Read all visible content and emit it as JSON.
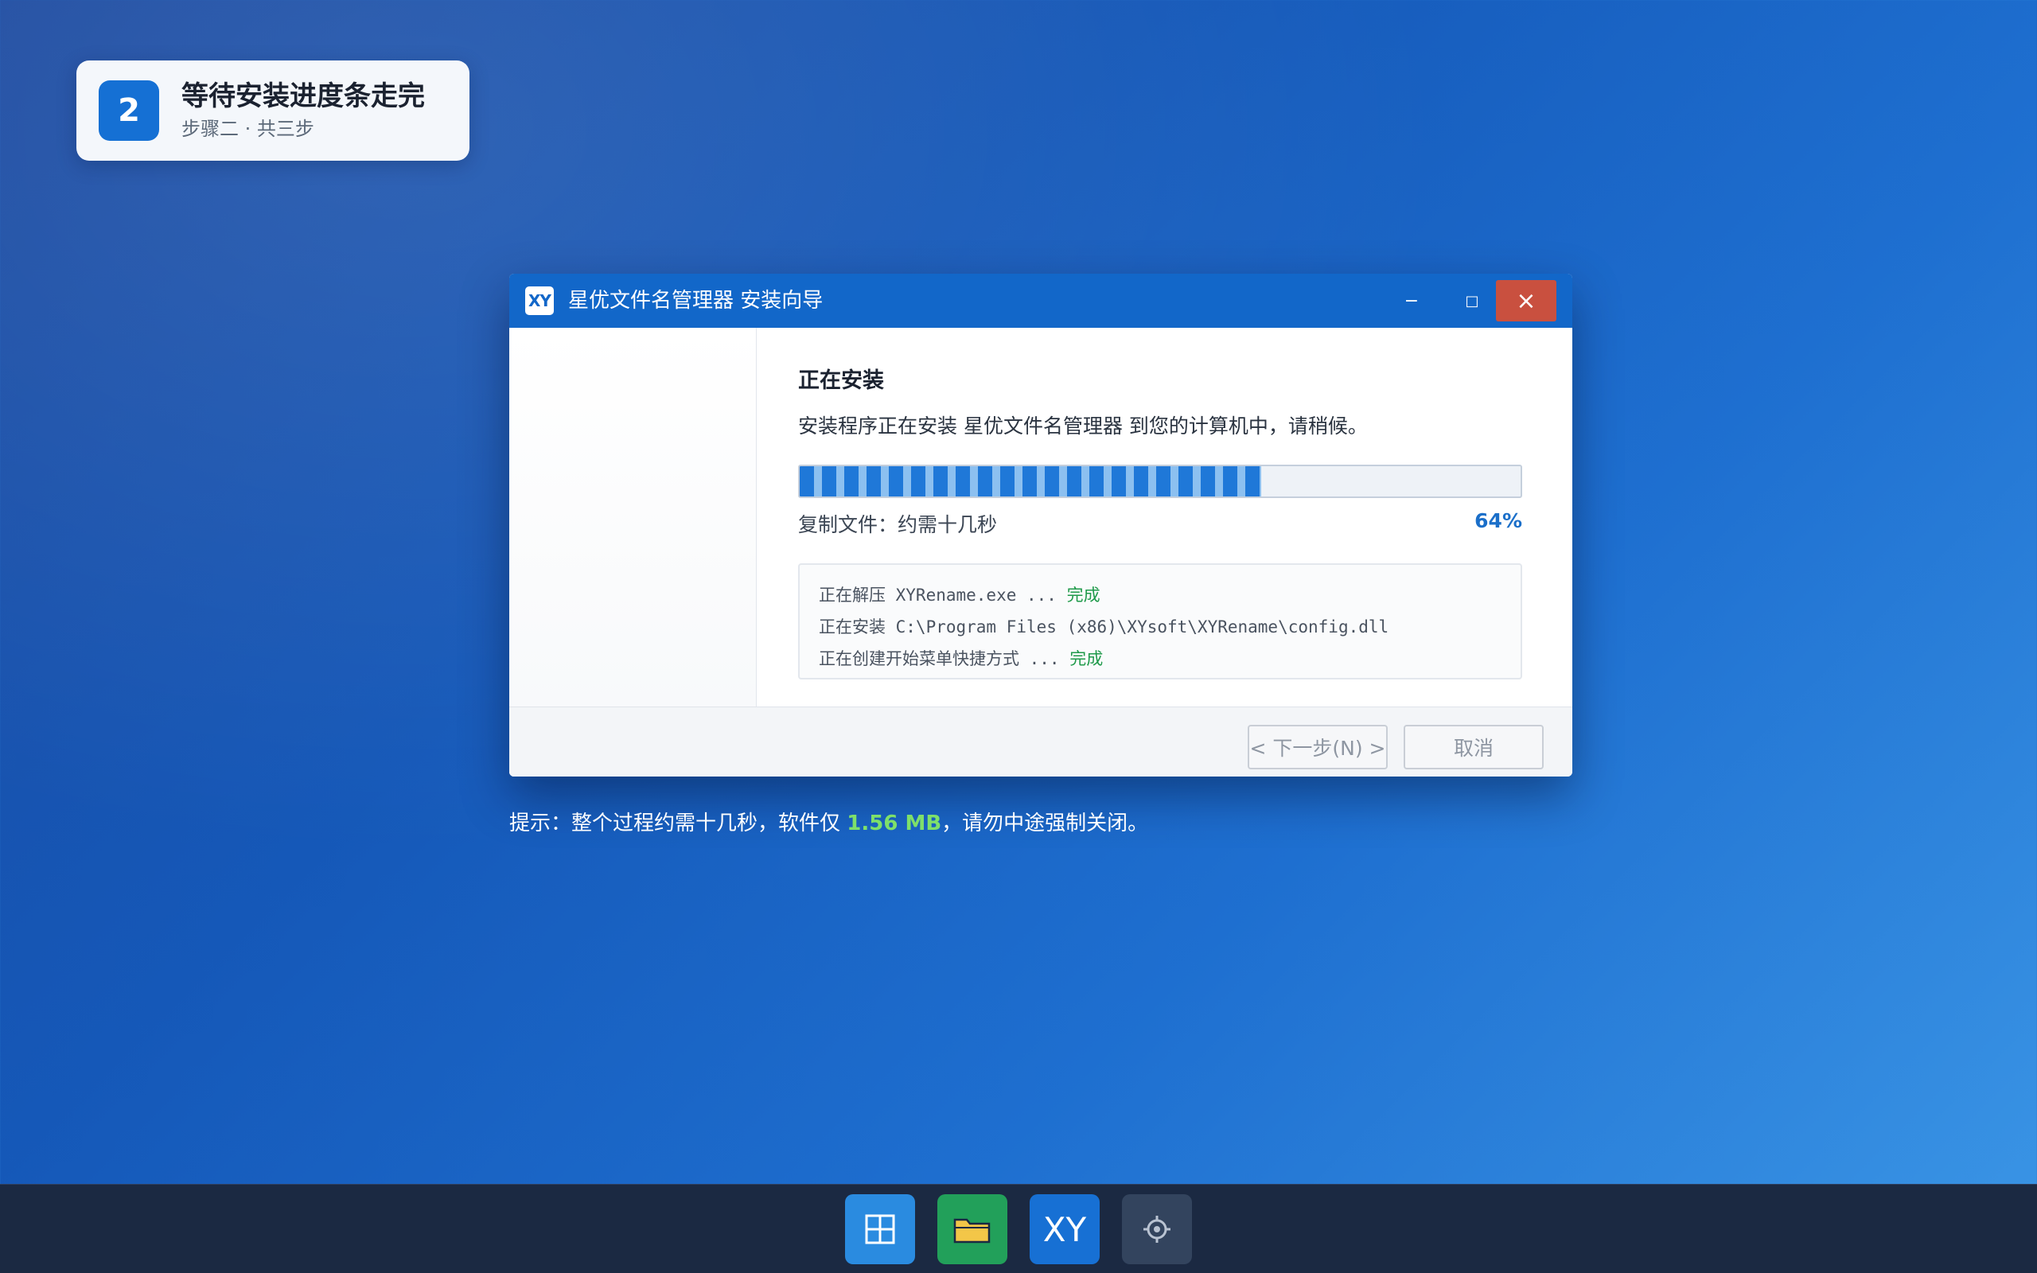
{
  "step": {
    "number": "2",
    "title": "等待安装进度条走完",
    "subtitle": "步骤二 · 共三步"
  },
  "window": {
    "icon_text": "XY",
    "title": "星优文件名管理器 安装向导",
    "minimize_glyph": "−",
    "maximize_glyph": "□",
    "close_glyph": "×"
  },
  "install": {
    "heading": "正在安装",
    "description": "安装程序正在安装 星优文件名管理器 到您的计算机中，请稍候。",
    "progress_value": 0.64,
    "progress_label": "复制文件：约需十几秒",
    "progress_percent": "64%",
    "log": [
      {
        "text": "正在解压 XYRename.exe ... ",
        "status": "完成"
      },
      {
        "text": "正在安装 C:\\Program Files (x86)\\XYsoft\\XYRename\\config.dll",
        "status": ""
      },
      {
        "text": "正在创建开始菜单快捷方式 ... ",
        "status": "完成"
      }
    ]
  },
  "buttons": {
    "next": "< 下一步(N) >",
    "cancel": "取消"
  },
  "hint": {
    "prefix": "提示：整个过程约需十几秒，软件仅 ",
    "size": "1.56 MB",
    "suffix": "，请勿中途强制关闭。"
  },
  "taskbar": {
    "apps": [
      {
        "name": "start-icon",
        "glyph": "⊞"
      },
      {
        "name": "folder-icon",
        "glyph": ""
      },
      {
        "name": "xy-app-icon",
        "glyph": "XY"
      },
      {
        "name": "settings-icon",
        "glyph": "⚙"
      }
    ]
  },
  "colors": {
    "accent": "#1267c9",
    "close": "#c9503f",
    "success": "#1f9a4a",
    "hint_highlight": "#7ee06a"
  }
}
